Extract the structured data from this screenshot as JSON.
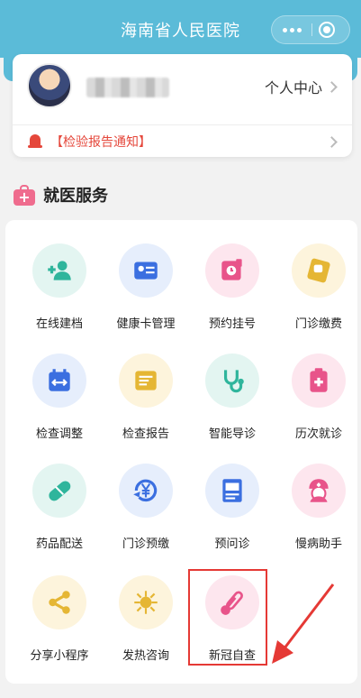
{
  "header": {
    "title": "海南省人民医院",
    "more_icon": "more-dots-icon",
    "close_icon": "target-close-icon"
  },
  "profile": {
    "center_label": "个人中心",
    "notice": "【检验报告通知】"
  },
  "section": {
    "title": "就医服务"
  },
  "services": [
    {
      "label": "在线建档",
      "icon": "add-user-icon",
      "bg": "#e3f5f1",
      "color": "#2fb59c"
    },
    {
      "label": "健康卡管理",
      "icon": "id-card-icon",
      "bg": "#e6eefc",
      "color": "#3b6fe0"
    },
    {
      "label": "预约挂号",
      "icon": "appointment-icon",
      "bg": "#fde6ee",
      "color": "#e8548a"
    },
    {
      "label": "门诊缴费",
      "icon": "payment-icon",
      "bg": "#fdf4dc",
      "color": "#e5b634"
    },
    {
      "label": "检查调整",
      "icon": "calendar-adjust-icon",
      "bg": "#e6eefc",
      "color": "#3b6fe0"
    },
    {
      "label": "检查报告",
      "icon": "report-icon",
      "bg": "#fdf4dc",
      "color": "#e5b634"
    },
    {
      "label": "智能导诊",
      "icon": "stethoscope-icon",
      "bg": "#e3f5f1",
      "color": "#2fb59c"
    },
    {
      "label": "历次就诊",
      "icon": "clipboard-plus-icon",
      "bg": "#fde6ee",
      "color": "#e8548a"
    },
    {
      "label": "药品配送",
      "icon": "capsule-icon",
      "bg": "#e3f5f1",
      "color": "#2fb59c"
    },
    {
      "label": "门诊预缴",
      "icon": "yen-refresh-icon",
      "bg": "#e6eefc",
      "color": "#3b6fe0"
    },
    {
      "label": "预问诊",
      "icon": "document-code-icon",
      "bg": "#e6eefc",
      "color": "#3b6fe0"
    },
    {
      "label": "慢病助手",
      "icon": "nurse-icon",
      "bg": "#fde6ee",
      "color": "#e8548a"
    },
    {
      "label": "分享小程序",
      "icon": "share-icon",
      "bg": "#fdf4dc",
      "color": "#e5b634"
    },
    {
      "label": "发热咨询",
      "icon": "virus-icon",
      "bg": "#fdf4dc",
      "color": "#e5b634"
    },
    {
      "label": "新冠自查",
      "icon": "thermometer-icon",
      "bg": "#fde6ee",
      "color": "#e8548a"
    }
  ],
  "colors": {
    "topbar": "#5bbbd8",
    "notice": "#e5473b",
    "highlight": "#e53935"
  }
}
